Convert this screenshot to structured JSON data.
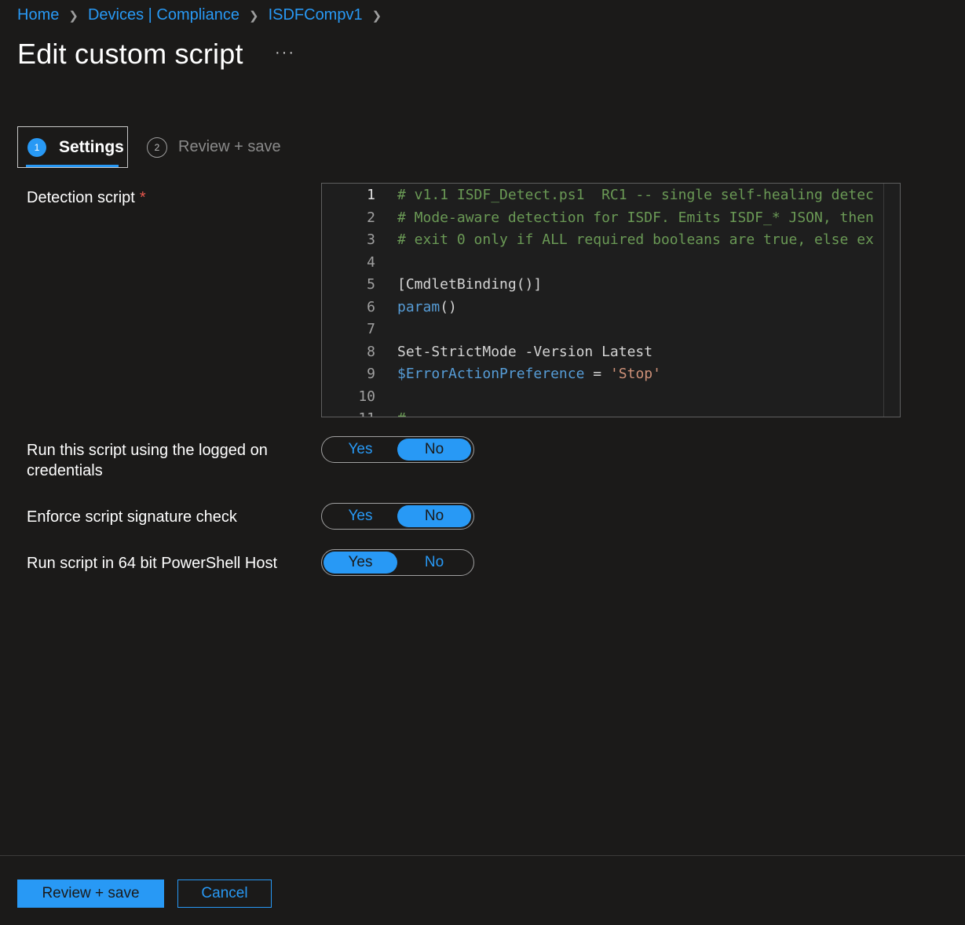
{
  "breadcrumb": {
    "items": [
      "Home",
      "Devices | Compliance",
      "ISDFCompv1"
    ]
  },
  "page": {
    "title": "Edit custom script",
    "more_label": "···"
  },
  "wizard": {
    "steps": [
      {
        "number": "1",
        "label": "Settings",
        "active": true
      },
      {
        "number": "2",
        "label": "Review + save",
        "active": false
      }
    ]
  },
  "detection": {
    "label": "Detection script",
    "required_mark": "*",
    "code_lines": [
      {
        "num": "1",
        "text": "# v1.1 ISDF_Detect.ps1  RC1 -- single self-healing detec"
      },
      {
        "num": "2",
        "text": "# Mode-aware detection for ISDF. Emits ISDF_* JSON, then"
      },
      {
        "num": "3",
        "text": "# exit 0 only if ALL required booleans are true, else ex"
      },
      {
        "num": "4",
        "text": ""
      },
      {
        "num": "5",
        "text": "[CmdletBinding()]"
      },
      {
        "num": "6",
        "parts": [
          "param",
          "()"
        ]
      },
      {
        "num": "7",
        "text": ""
      },
      {
        "num": "8",
        "text": "Set-StrictMode -Version Latest"
      },
      {
        "num": "9",
        "parts": [
          "$ErrorActionPreference",
          " = ",
          "'Stop'"
        ]
      },
      {
        "num": "10",
        "text": ""
      },
      {
        "num": "11",
        "text": "# -----------------------------------------------------"
      }
    ]
  },
  "options": [
    {
      "label": "Run this script using the logged on credentials",
      "yes": "Yes",
      "no": "No",
      "selected": "No"
    },
    {
      "label": "Enforce script signature check",
      "yes": "Yes",
      "no": "No",
      "selected": "No"
    },
    {
      "label": "Run script in 64 bit PowerShell Host",
      "yes": "Yes",
      "no": "No",
      "selected": "Yes"
    }
  ],
  "footer": {
    "primary_label": "Review + save",
    "cancel_label": "Cancel"
  },
  "colors": {
    "accent": "#2899f5",
    "background": "#1b1a19",
    "required": "#e8574d"
  }
}
